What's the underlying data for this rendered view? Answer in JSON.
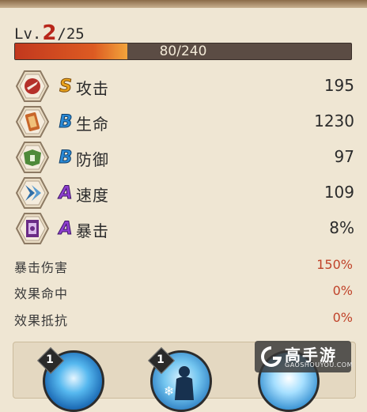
{
  "level": {
    "prefix": "Lv.",
    "current": "2",
    "max": "/25"
  },
  "exp": {
    "text": "80/240",
    "current": 80,
    "max": 240
  },
  "stats": [
    {
      "icon": "attack-icon",
      "grade": "S",
      "grade_color": "#e9a21c",
      "label": "攻击",
      "value": "195"
    },
    {
      "icon": "health-icon",
      "grade": "B",
      "grade_color": "#2a8ad6",
      "label": "生命",
      "value": "1230"
    },
    {
      "icon": "defense-icon",
      "grade": "B",
      "grade_color": "#2a8ad6",
      "label": "防御",
      "value": "97"
    },
    {
      "icon": "speed-icon",
      "grade": "A",
      "grade_color": "#8e3fd0",
      "label": "速度",
      "value": "109"
    },
    {
      "icon": "crit-icon",
      "grade": "A",
      "grade_color": "#8e3fd0",
      "label": "暴击",
      "value": "8%"
    }
  ],
  "sub_stats": [
    {
      "label": "暴击伤害",
      "value": "150%"
    },
    {
      "label": "效果命中",
      "value": "0%"
    },
    {
      "label": "效果抵抗",
      "value": "0%"
    }
  ],
  "skills": [
    {
      "icon": "skill-orb-icon",
      "level": "1"
    },
    {
      "icon": "skill-silhouette-icon",
      "level": "1"
    },
    {
      "icon": "skill-frost-icon"
    }
  ],
  "watermark": {
    "title": "高手游",
    "sub": "GAOSHOUYOU.COM"
  },
  "colors": {
    "accent": "#b8261a",
    "exp_fill": "#dd5b22",
    "sub_value": "#c0432a",
    "background": "#efe6d3"
  }
}
